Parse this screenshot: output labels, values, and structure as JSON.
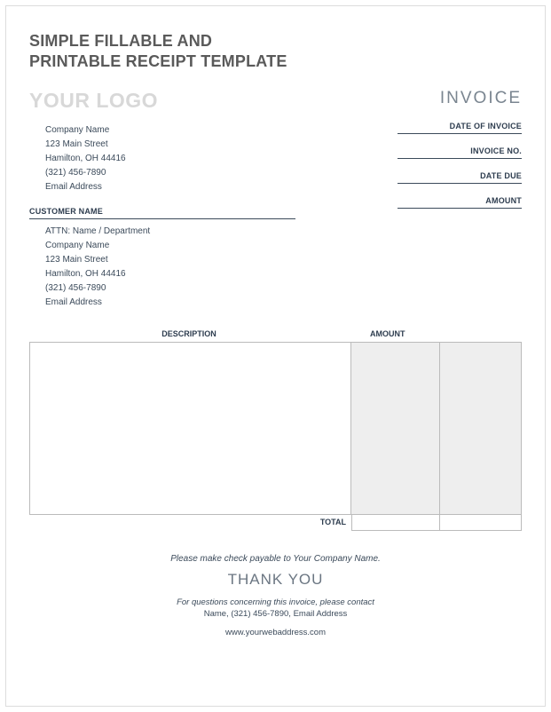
{
  "title_line1": "SIMPLE FILLABLE AND",
  "title_line2": "PRINTABLE RECEIPT TEMPLATE",
  "logo_text": "YOUR LOGO",
  "invoice_text": "INVOICE",
  "company": {
    "name": "Company Name",
    "street": "123 Main Street",
    "citystate": "Hamilton, OH  44416",
    "phone": "(321) 456-7890",
    "email": "Email Address"
  },
  "customer_header": "CUSTOMER NAME",
  "customer": {
    "attn": "ATTN: Name / Department",
    "name": "Company Name",
    "street": "123 Main Street",
    "citystate": "Hamilton, OH  44416",
    "phone": "(321) 456-7890",
    "email": "Email Address"
  },
  "meta": {
    "date_of_invoice": "DATE OF INVOICE",
    "invoice_no": "INVOICE NO.",
    "date_due": "DATE DUE",
    "amount": "AMOUNT"
  },
  "table": {
    "description_header": "DESCRIPTION",
    "amount_header": "AMOUNT",
    "total_label": "TOTAL"
  },
  "footer": {
    "payable": "Please make check payable to Your Company Name.",
    "thanks": "THANK YOU",
    "contact1": "For questions concerning this invoice, please contact",
    "contact2": "Name, (321) 456-7890, Email Address",
    "web": "www.yourwebaddress.com"
  }
}
